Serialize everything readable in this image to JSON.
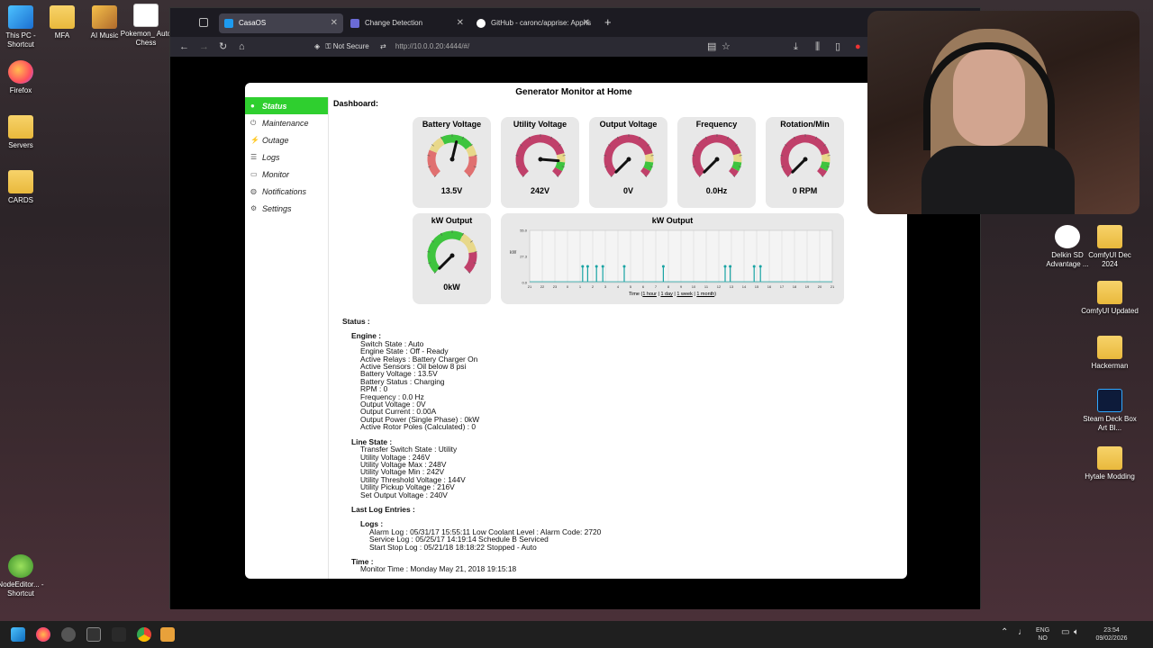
{
  "desktop": {
    "icons_left": [
      {
        "label": "This PC - Shortcut",
        "icon": "computer-icon"
      },
      {
        "label": "Firefox",
        "icon": "firefox-icon"
      },
      {
        "label": "Servers",
        "icon": "folder-icon"
      },
      {
        "label": "CARDS",
        "icon": "folder-icon"
      },
      {
        "label": "NodeEditor... - Shortcut",
        "icon": "app-icon"
      }
    ],
    "icons_top": [
      {
        "label": "MFA",
        "icon": "folder-icon"
      },
      {
        "label": "AI Music",
        "icon": "folder-icon"
      },
      {
        "label": "Pokemon_ Auto Chess",
        "icon": "app-icon"
      }
    ],
    "icons_right": [
      {
        "label": "Delkin SD Advantage ...",
        "icon": "app-icon"
      },
      {
        "label": "ComfyUI Dec 2024",
        "icon": "folder-icon"
      },
      {
        "label": "ComfyUI Updated",
        "icon": "folder-icon"
      },
      {
        "label": "Hackerman",
        "icon": "folder-icon"
      },
      {
        "label": "Steam Deck Box Art Bl...",
        "icon": "photoshop-icon"
      },
      {
        "label": "Hytale Modding",
        "icon": "folder-icon"
      }
    ]
  },
  "browser": {
    "tabs": [
      {
        "label": "CasaOS",
        "active": true
      },
      {
        "label": "Change Detection",
        "active": false
      },
      {
        "label": "GitHub - caronc/apprise: Appris",
        "active": false
      }
    ],
    "security": "Not Secure",
    "url": "http://10.0.0.20:4444/#/"
  },
  "app": {
    "title": "Generator Monitor at Home",
    "menu": [
      {
        "label": "Status",
        "icon": "status-icon",
        "glyph": "●",
        "active": true
      },
      {
        "label": "Maintenance",
        "icon": "power-icon",
        "glyph": "⏻",
        "active": false
      },
      {
        "label": "Outage",
        "icon": "bolt-icon",
        "glyph": "⚡",
        "active": false
      },
      {
        "label": "Logs",
        "icon": "list-icon",
        "glyph": "☰",
        "active": false
      },
      {
        "label": "Monitor",
        "icon": "monitor-icon",
        "glyph": "▭",
        "active": false
      },
      {
        "label": "Notifications",
        "icon": "globe-icon",
        "glyph": "◍",
        "active": false
      },
      {
        "label": "Settings",
        "icon": "gear-icon",
        "glyph": "⚙",
        "active": false
      }
    ],
    "dashboard_label": "Dashboard:",
    "gauges": [
      {
        "title": "Battery Voltage",
        "value": "13.5V",
        "fraction": 0.55
      },
      {
        "title": "Utility Voltage",
        "value": "242V",
        "fraction": 0.85
      },
      {
        "title": "Output Voltage",
        "value": "0V",
        "fraction": 0.0
      },
      {
        "title": "Frequency",
        "value": "0.0Hz",
        "fraction": 0.0
      },
      {
        "title": "Rotation/Min",
        "value": "0 RPM",
        "fraction": 0.0
      },
      {
        "title": "kW Output",
        "value": "0kW",
        "fraction": 0.0
      }
    ],
    "kw_chart": {
      "title": "kW Output",
      "footer_prefix": "Time (",
      "links": [
        "1 hour",
        "1 day",
        "1 week",
        "1 month"
      ],
      "ylabel": "kW",
      "y_ticks": [
        "0.0",
        "27.3",
        "55.0"
      ],
      "x_ticks": [
        "21",
        "22",
        "23",
        "0",
        "1",
        "2",
        "3",
        "4",
        "5",
        "6",
        "7",
        "8",
        "9",
        "10",
        "11",
        "12",
        "13",
        "14",
        "15",
        "16",
        "17",
        "18",
        "19",
        "20",
        "21"
      ],
      "spikes": [
        4.2,
        4.6,
        5.3,
        5.8,
        7.5,
        10.6,
        15.5,
        15.9,
        17.8,
        18.3
      ]
    },
    "status_title": "Status :",
    "engine": {
      "heading": "Engine :",
      "lines": [
        "Switch State : Auto",
        "Engine State : Off - Ready",
        "Active Relays : Battery Charger On",
        "Active Sensors : Oil below 8 psi",
        "Battery Voltage : 13.5V",
        "Battery Status : Charging",
        "RPM : 0",
        "Frequency : 0.0 Hz",
        "Output Voltage : 0V",
        "Output Current : 0.00A",
        "Output Power (Single Phase) : 0kW",
        "Active Rotor Poles (Calculated) : 0"
      ]
    },
    "line_state": {
      "heading": "Line State :",
      "lines": [
        "Transfer Switch State : Utility",
        "Utility Voltage : 246V",
        "Utility Voltage Max : 248V",
        "Utility Voltage Min : 242V",
        "Utility Threshold Voltage : 144V",
        "Utility Pickup Voltage : 216V",
        "Set Output Voltage : 240V"
      ]
    },
    "last_log": {
      "heading": "Last Log Entries :",
      "sub": "Logs :",
      "lines": [
        "Alarm Log : 05/31/17 15:55:11 Low Coolant Level : Alarm Code: 2720",
        "Service Log : 05/25/17 14:19:14 Schedule B Serviced",
        "Start Stop Log : 05/21/18 18:18:22 Stopped - Auto"
      ]
    },
    "time": {
      "heading": "Time :",
      "monitor_time": "Monitor Time : Monday May 21, 2018 19:15:18"
    }
  },
  "taskbar": {
    "lang": "ENG",
    "region": "NO",
    "time": "23:54",
    "date": "09/02/2026"
  }
}
